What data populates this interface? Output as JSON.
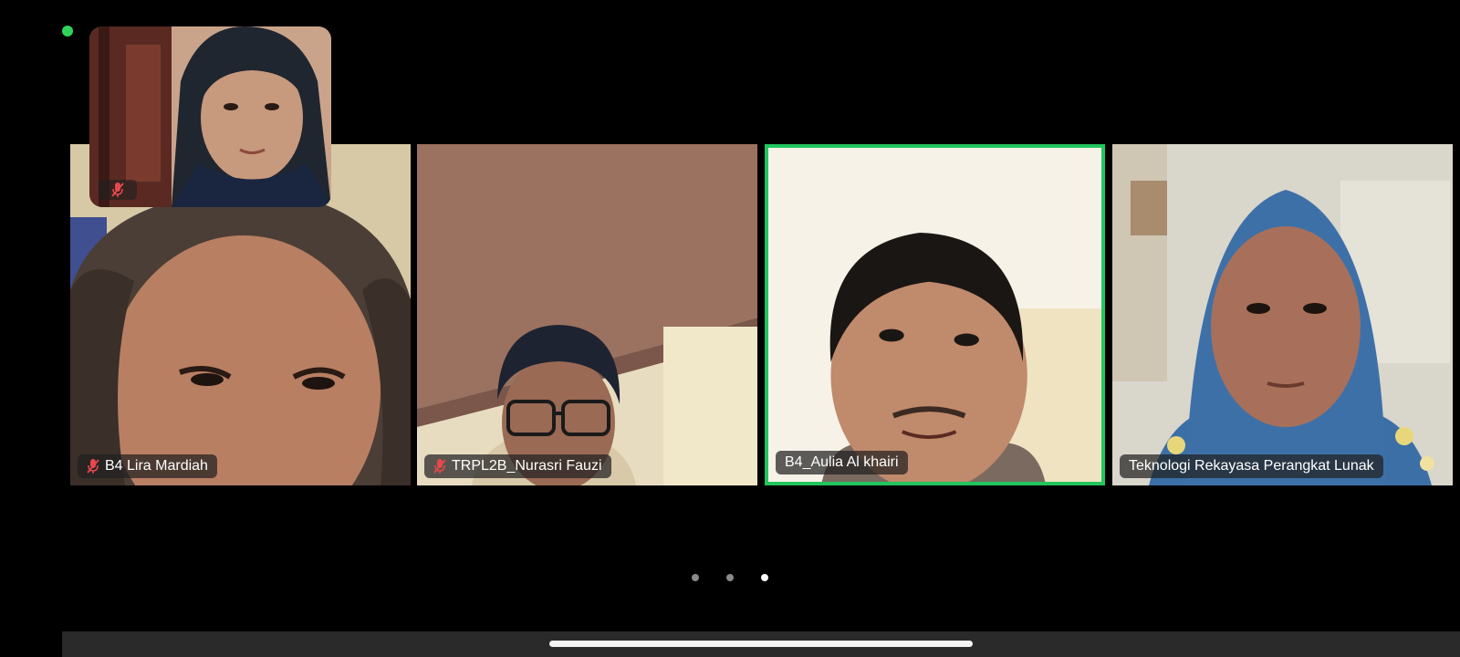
{
  "meeting": {
    "participants": [
      {
        "name": "B4 Lira Mardiah",
        "muted": true,
        "active_speaker": false
      },
      {
        "name": "TRPL2B_Nurasri Fauzi",
        "muted": true,
        "active_speaker": false
      },
      {
        "name": "B4_Aulia Al khairi",
        "muted": false,
        "active_speaker": true
      },
      {
        "name": "Teknologi Rekayasa Perangkat Lunak",
        "muted": false,
        "active_speaker": false
      }
    ],
    "self_view": {
      "muted": true
    },
    "pagination": {
      "pages": 3,
      "current": 3
    }
  },
  "colors": {
    "active_speaker_border": "#22c55e",
    "connection_indicator": "#2fd35a",
    "mute_icon": "#e5484d"
  },
  "icons": {
    "mute": "mic-off-icon",
    "status": "connection-status-dot"
  }
}
